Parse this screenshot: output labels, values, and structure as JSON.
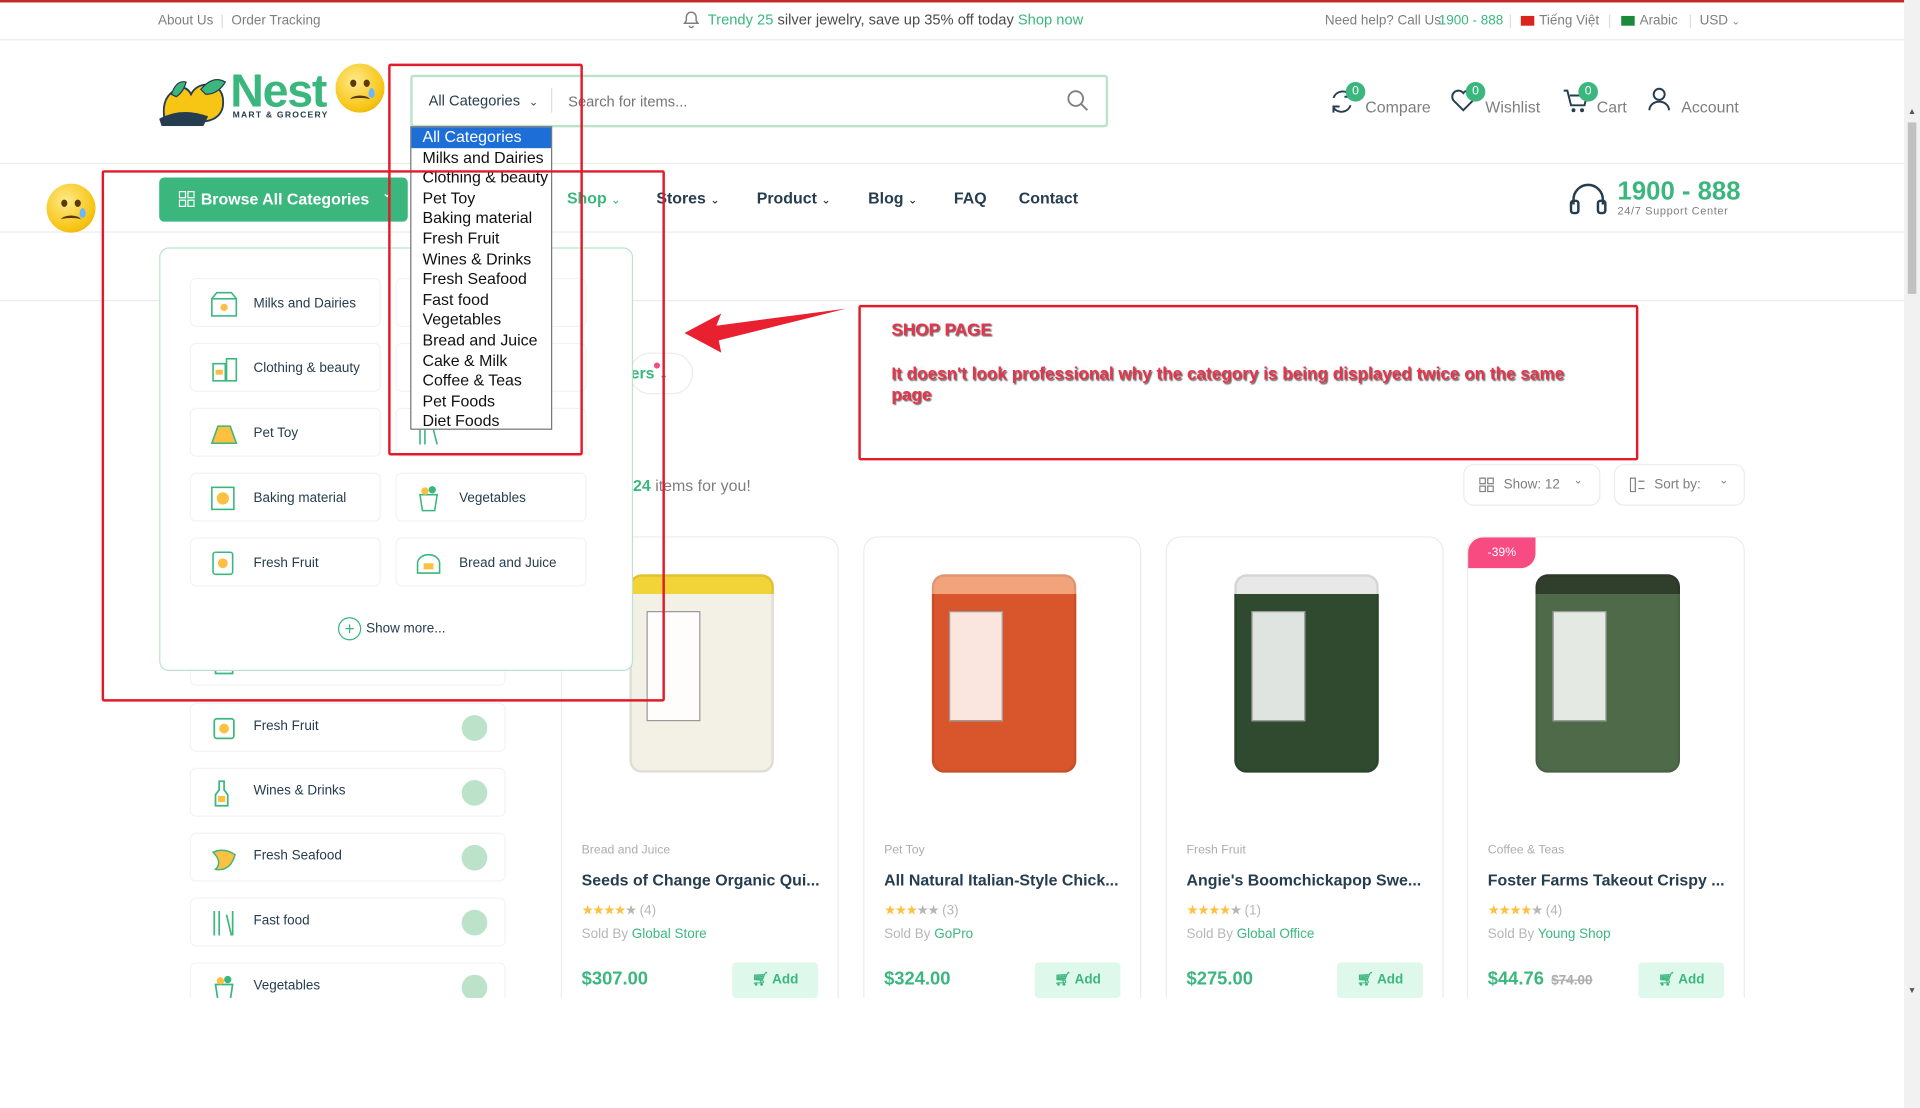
{
  "topbar": {
    "about": "About Us",
    "tracking": "Order Tracking",
    "promo_pre": "Trendy ",
    "promo_num": "25",
    "promo_mid": " silver jewelry, save up 35% off today ",
    "promo_link": "Shop now",
    "help": "Need help? Call Us:",
    "help_phone": "1900 - 888",
    "lang": "Tiếng Việt",
    "lang2": "Arabic",
    "currency": "USD"
  },
  "logo": {
    "name": "Nest",
    "tagline": "MART & GROCERY"
  },
  "search": {
    "category": "All Categories",
    "placeholder": "Search for items..."
  },
  "header_actions": [
    {
      "label": "Compare",
      "count": "0"
    },
    {
      "label": "Wishlist",
      "count": "0"
    },
    {
      "label": "Cart",
      "count": "0"
    },
    {
      "label": "Account"
    }
  ],
  "nav": {
    "browse": "Browse All Categories",
    "links": [
      "Shop",
      "Stores",
      "Product",
      "Blog",
      "FAQ",
      "Contact"
    ],
    "phone": "1900 - 888",
    "phone_sub": "24/7 Support Center"
  },
  "mega_menu": {
    "left": [
      "Milks and Dairies",
      "Clothing & beauty",
      "Pet Toy",
      "Baking material",
      "Fresh Fruit"
    ],
    "right": [
      "",
      "",
      "",
      "Vegetables",
      "Bread and Juice"
    ],
    "right_peek": [
      "s",
      "d",
      "Fast food"
    ],
    "show_more": "Show more..."
  },
  "category_dropdown": [
    "All Categories",
    "Milks and Dairies",
    "Clothing & beauty",
    "Pet Toy",
    "Baking material",
    "Fresh Fruit",
    "Wines & Drinks",
    "Fresh Seafood",
    "Fast food",
    "Vegetables",
    "Bread and Juice",
    "Cake & Milk",
    "Coffee & Teas",
    "Pet Foods",
    "Diet Foods"
  ],
  "sidebar_categories": [
    "Fresh Fruit",
    "Wines & Drinks",
    "Fresh Seafood",
    "Fast food",
    "Vegetables"
  ],
  "filter_peek": "ers",
  "results": {
    "count": "24",
    "suffix": " items for you!",
    "show": "Show: 12",
    "sort": "Sort by:"
  },
  "annotation": {
    "title": "SHOP PAGE",
    "message": "It doesn't look professional why the category is being displayed twice on the same page"
  },
  "products": [
    {
      "category": "Bread and Juice",
      "name": "Seeds of Change Organic Qui...",
      "rating": "(4)",
      "sold_by": "Sold By ",
      "vendor": "Global Store",
      "price": "$307.00",
      "old_price": "",
      "add": "Add",
      "discount": "",
      "color": "#f3f0e6",
      "accent": "#f2d338"
    },
    {
      "category": "Pet Toy",
      "name": "All Natural Italian-Style Chick...",
      "rating": "(3)",
      "sold_by": "Sold By ",
      "vendor": "GoPro",
      "price": "$324.00",
      "old_price": "",
      "add": "Add",
      "discount": "",
      "color": "#d9552c",
      "accent": "#f2a37c"
    },
    {
      "category": "Fresh Fruit",
      "name": "Angie's Boomchickapop Swe...",
      "rating": "(1)",
      "sold_by": "Sold By ",
      "vendor": "Global Office",
      "price": "$275.00",
      "old_price": "",
      "add": "Add",
      "discount": "",
      "color": "#2f4a2f",
      "accent": "#e8e8e8"
    },
    {
      "category": "Coffee & Teas",
      "name": "Foster Farms Takeout Crispy ...",
      "rating": "(4)",
      "sold_by": "Sold By ",
      "vendor": "Young Shop",
      "price": "$44.76",
      "old_price": "$74.00",
      "add": "Add",
      "discount": "-39%",
      "color": "#4f6a48",
      "accent": "#2f3f2c"
    }
  ],
  "colors": {
    "brand": "#3bb77e",
    "brand_light": "#bce3c9",
    "annotation_red": "#e11b2a"
  }
}
